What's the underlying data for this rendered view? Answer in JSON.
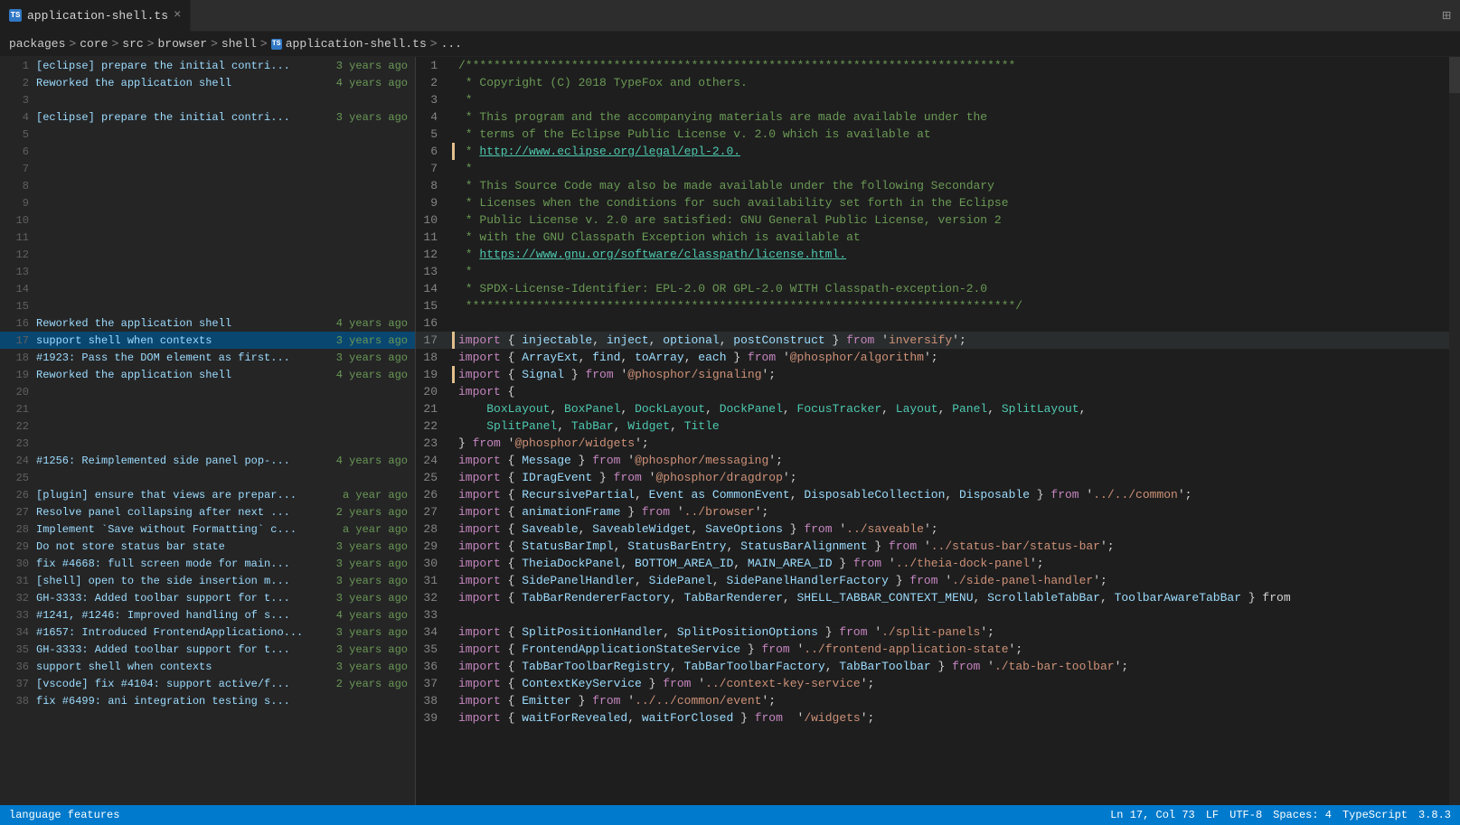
{
  "tab": {
    "icon_label": "TS",
    "filename": "application-shell.ts",
    "close_label": "×"
  },
  "breadcrumb": {
    "parts": [
      "packages",
      "core",
      "src",
      "browser",
      "shell",
      "application-shell.ts",
      "..."
    ],
    "separators": [
      ">",
      ">",
      ">",
      ">",
      ">",
      ">"
    ]
  },
  "blame_rows": [
    {
      "num": 1,
      "text": "[eclipse] prepare the initial contri...",
      "time": "3 years ago",
      "active": false
    },
    {
      "num": 2,
      "text": "Reworked the application shell",
      "time": "4 years ago",
      "active": false
    },
    {
      "num": 3,
      "text": "",
      "time": "",
      "active": false
    },
    {
      "num": 4,
      "text": "[eclipse] prepare the initial contri...",
      "time": "3 years ago",
      "active": false
    },
    {
      "num": 5,
      "text": "",
      "time": "",
      "active": false
    },
    {
      "num": 6,
      "text": "",
      "time": "",
      "active": false
    },
    {
      "num": 7,
      "text": "",
      "time": "",
      "active": false
    },
    {
      "num": 8,
      "text": "",
      "time": "",
      "active": false
    },
    {
      "num": 9,
      "text": "",
      "time": "",
      "active": false
    },
    {
      "num": 10,
      "text": "",
      "time": "",
      "active": false
    },
    {
      "num": 11,
      "text": "",
      "time": "",
      "active": false
    },
    {
      "num": 12,
      "text": "",
      "time": "",
      "active": false
    },
    {
      "num": 13,
      "text": "",
      "time": "",
      "active": false
    },
    {
      "num": 14,
      "text": "",
      "time": "",
      "active": false
    },
    {
      "num": 15,
      "text": "",
      "time": "",
      "active": false
    },
    {
      "num": 16,
      "text": "Reworked the application shell",
      "time": "4 years ago",
      "active": false
    },
    {
      "num": 17,
      "text": "support shell when contexts",
      "time": "3 years ago",
      "active": true
    },
    {
      "num": 18,
      "text": "#1923: Pass the DOM element as first...",
      "time": "3 years ago",
      "active": false
    },
    {
      "num": 19,
      "text": "Reworked the application shell",
      "time": "4 years ago",
      "active": false
    },
    {
      "num": 20,
      "text": "",
      "time": "",
      "active": false
    },
    {
      "num": 21,
      "text": "",
      "time": "",
      "active": false
    },
    {
      "num": 22,
      "text": "",
      "time": "",
      "active": false
    },
    {
      "num": 23,
      "text": "",
      "time": "",
      "active": false
    },
    {
      "num": 24,
      "text": "#1256: Reimplemented side panel pop-...",
      "time": "4 years ago",
      "active": false
    },
    {
      "num": 25,
      "text": "",
      "time": "",
      "active": false
    },
    {
      "num": 26,
      "text": "[plugin] ensure that views are prepar...",
      "time": "a year ago",
      "active": false
    },
    {
      "num": 27,
      "text": "Resolve panel collapsing after next ...",
      "time": "2 years ago",
      "active": false
    },
    {
      "num": 28,
      "text": "Implement `Save without Formatting` c...",
      "time": "a year ago",
      "active": false
    },
    {
      "num": 29,
      "text": "Do not store status bar state",
      "time": "3 years ago",
      "active": false
    },
    {
      "num": 30,
      "text": "fix #4668: full screen mode for main...",
      "time": "3 years ago",
      "active": false
    },
    {
      "num": 31,
      "text": "[shell] open to the side insertion m...",
      "time": "3 years ago",
      "active": false
    },
    {
      "num": 32,
      "text": "GH-3333: Added toolbar support for t...",
      "time": "3 years ago",
      "active": false
    },
    {
      "num": 33,
      "text": "#1241, #1246: Improved handling of s...",
      "time": "4 years ago",
      "active": false
    },
    {
      "num": 34,
      "text": "#1657: Introduced FrontendApplicationo...",
      "time": "3 years ago",
      "active": false
    },
    {
      "num": 35,
      "text": "GH-3333: Added toolbar support for t...",
      "time": "3 years ago",
      "active": false
    },
    {
      "num": 36,
      "text": "support shell when contexts",
      "time": "3 years ago",
      "active": false
    },
    {
      "num": 37,
      "text": "[vscode] fix #4104: support active/f...",
      "time": "2 years ago",
      "active": false
    },
    {
      "num": 38,
      "text": "fix #6499: ani integration testing s...",
      "time": "",
      "active": false
    }
  ],
  "code_lines": [
    {
      "num": 1,
      "content": "/******************************************************************************"
    },
    {
      "num": 2,
      "content": " * Copyright (C) 2018 TypeFox and others."
    },
    {
      "num": 3,
      "content": " *"
    },
    {
      "num": 4,
      "content": " * This program and the accompanying materials are made available under the"
    },
    {
      "num": 5,
      "content": " * terms of the Eclipse Public License v. 2.0 which is available at"
    },
    {
      "num": 6,
      "content": " * http://www.eclipse.org/legal/epl-2.0."
    },
    {
      "num": 7,
      "content": " *"
    },
    {
      "num": 8,
      "content": " * This Source Code may also be made available under the following Secondary"
    },
    {
      "num": 9,
      "content": " * Licenses when the conditions for such availability set forth in the Eclipse"
    },
    {
      "num": 10,
      "content": " * Public License v. 2.0 are satisfied: GNU General Public License, version 2"
    },
    {
      "num": 11,
      "content": " * with the GNU Classpath Exception which is available at"
    },
    {
      "num": 12,
      "content": " * https://www.gnu.org/software/classpath/license.html."
    },
    {
      "num": 13,
      "content": " *"
    },
    {
      "num": 14,
      "content": " * SPDX-License-Identifier: EPL-2.0 OR GPL-2.0 WITH Classpath-exception-2.0"
    },
    {
      "num": 15,
      "content": " ******************************************************************************/"
    },
    {
      "num": 16,
      "content": ""
    },
    {
      "num": 17,
      "content": "import { injectable, inject, optional, postConstruct } from 'inversify';",
      "active": true
    },
    {
      "num": 18,
      "content": "import { ArrayExt, find, toArray, each } from '@phosphor/algorithm';"
    },
    {
      "num": 19,
      "content": "import { Signal } from '@phosphor/signaling';"
    },
    {
      "num": 20,
      "content": "import {"
    },
    {
      "num": 21,
      "content": "    BoxLayout, BoxPanel, DockLayout, DockPanel, FocusTracker, Layout, Panel, SplitLayout,"
    },
    {
      "num": 22,
      "content": "    SplitPanel, TabBar, Widget, Title"
    },
    {
      "num": 23,
      "content": "} from '@phosphor/widgets';"
    },
    {
      "num": 24,
      "content": "import { Message } from '@phosphor/messaging';"
    },
    {
      "num": 25,
      "content": "import { IDragEvent } from '@phosphor/dragdrop';"
    },
    {
      "num": 26,
      "content": "import { RecursivePartial, Event as CommonEvent, DisposableCollection, Disposable } from '../../common';"
    },
    {
      "num": 27,
      "content": "import { animationFrame } from '../browser';"
    },
    {
      "num": 28,
      "content": "import { Saveable, SaveableWidget, SaveOptions } from '../saveable';"
    },
    {
      "num": 29,
      "content": "import { StatusBarImpl, StatusBarEntry, StatusBarAlignment } from '../status-bar/status-bar';"
    },
    {
      "num": 30,
      "content": "import { TheiaDockPanel, BOTTOM_AREA_ID, MAIN_AREA_ID } from '../theia-dock-panel';"
    },
    {
      "num": 31,
      "content": "import { SidePanelHandler, SidePanel, SidePanelHandlerFactory } from './side-panel-handler';"
    },
    {
      "num": 32,
      "content": "import { TabBarRendererFactory, TabBarRenderer, SHELL_TABBAR_CONTEXT_MENU, ScrollableTabBar, ToolbarAwareTabBar } from"
    },
    {
      "num": 33,
      "content": ""
    },
    {
      "num": 34,
      "content": "import { SplitPositionHandler, SplitPositionOptions } from './split-panels';"
    },
    {
      "num": 35,
      "content": "import { FrontendApplicationStateService } from '../frontend-application-state';"
    },
    {
      "num": 36,
      "content": "import { TabBarToolbarRegistry, TabBarToolbarFactory, TabBarToolbar } from './tab-bar-toolbar';"
    },
    {
      "num": 37,
      "content": "import { ContextKeyService } from '../context-key-service';"
    },
    {
      "num": 38,
      "content": "import { Emitter } from '../../common/event';"
    },
    {
      "num": 39,
      "content": "import { waitForRevealed, waitForClosed } from  '/widgets';"
    }
  ],
  "status_bar": {
    "branch": "Ln 17, Col 73",
    "encoding": "LF",
    "file_type": "UTF-8",
    "spaces": "Spaces: 4",
    "language": "TypeScript",
    "version": "3.8.3",
    "left_label": "language features"
  }
}
